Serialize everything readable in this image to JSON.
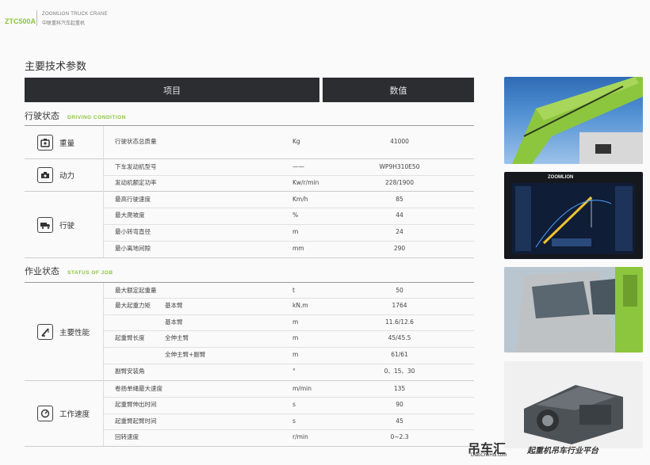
{
  "header": {
    "model": "ZTC500A",
    "brand_en": "ZOOMLION TRUCK CRANE",
    "brand_cn": "中联重科汽车起重机"
  },
  "title": "主要技术参数",
  "table_head": {
    "item": "项目",
    "value": "数值"
  },
  "sections": {
    "driving": {
      "cn": "行驶状态",
      "en": "DRIVING CONDITION"
    },
    "job": {
      "cn": "作业状态",
      "en": "STATUS OF JOB"
    }
  },
  "categories": {
    "weight": {
      "label": "重量",
      "icon": "scale-icon"
    },
    "power": {
      "label": "动力",
      "icon": "engine-icon"
    },
    "drive": {
      "label": "行驶",
      "icon": "truck-icon"
    },
    "perf": {
      "label": "主要性能",
      "icon": "crane-boom-icon"
    },
    "speed": {
      "label": "工作速度",
      "icon": "speedometer-icon"
    }
  },
  "rows": [
    {
      "name": "行驶状态总质量",
      "unit": "Kg",
      "value": "41000"
    },
    {
      "name": "下车发动机型号",
      "unit": "——",
      "value": "WP9H310E50"
    },
    {
      "name": "发动机额定功率",
      "unit": "Kw/r/min",
      "value": "228/1900"
    },
    {
      "name": "最高行驶速度",
      "unit": "Km/h",
      "value": "85"
    },
    {
      "name": "最大爬坡度",
      "unit": "%",
      "value": "44"
    },
    {
      "name": "最小转弯直径",
      "unit": "m",
      "value": "24"
    },
    {
      "name": "最小离地间隙",
      "unit": "mm",
      "value": "290"
    },
    {
      "name": "最大额定起重量",
      "unit": "t",
      "value": "50"
    },
    {
      "name": "最大起重力矩",
      "sub": "基本臂",
      "unit": "kN.m",
      "value": "1764"
    },
    {
      "name": "",
      "sub": "基本臂",
      "unit": "m",
      "value": "11.6/12.6"
    },
    {
      "name": "起重臂长度",
      "sub": "全伸主臂",
      "unit": "m",
      "value": "45/45.5"
    },
    {
      "name": "",
      "sub": "全伸主臂+副臂",
      "unit": "m",
      "value": "61/61"
    },
    {
      "name": "副臂安装角",
      "unit": "°",
      "value": "0、15、30"
    },
    {
      "name": "卷扬单绳最大速度",
      "unit": "m/min",
      "value": "135"
    },
    {
      "name": "起重臂伸出时间",
      "unit": "s",
      "value": "90"
    },
    {
      "name": "起重臂起臂时间",
      "unit": "s",
      "value": "45"
    },
    {
      "name": "回转速度",
      "unit": "r/min",
      "value": "0~2.3"
    }
  ],
  "photos": {
    "screen_logo": "ZOOMLION"
  },
  "watermark": {
    "cn": "吊车汇",
    "url": "DiaoCheHui.com",
    "slogan": "起重机吊车行业平台"
  },
  "colors": {
    "accent": "#8cc63e",
    "header_bg": "#2b2d30"
  }
}
